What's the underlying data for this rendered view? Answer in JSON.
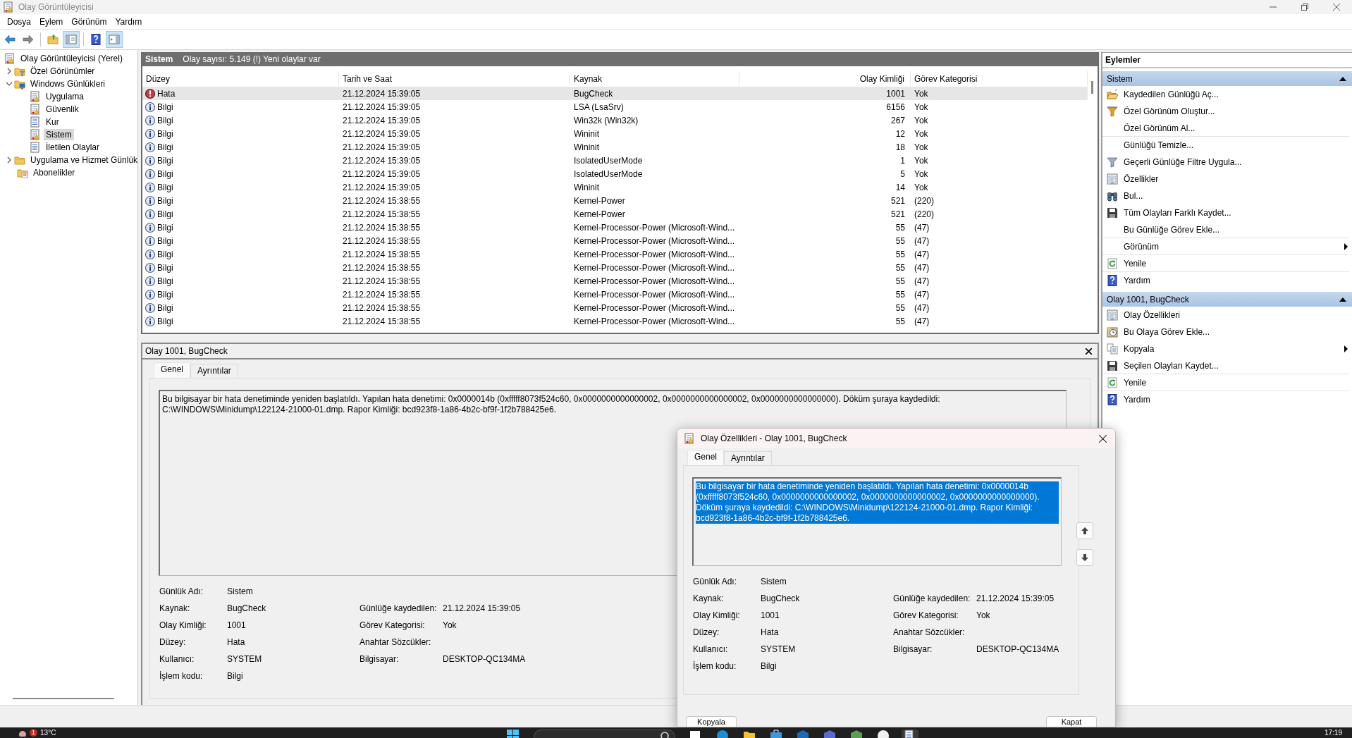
{
  "window": {
    "title": "Olay Görüntüleyicisi"
  },
  "menu": [
    "Dosya",
    "Eylem",
    "Görünüm",
    "Yardım"
  ],
  "toolbar": [
    {
      "kind": "back",
      "pressed": false
    },
    {
      "kind": "forward",
      "pressed": false
    },
    {
      "kind": "up-folder",
      "pressed": false
    },
    {
      "kind": "tree-pane",
      "pressed": true
    },
    {
      "kind": "help",
      "pressed": false
    },
    {
      "kind": "action-pane",
      "pressed": true
    }
  ],
  "tree": [
    {
      "label": "Olay Görüntüleyicisi (Yerel)",
      "kind": "log",
      "selected": false,
      "children": [
        {
          "label": "Özel Görünümler",
          "kind": "folder-filter",
          "selected": false,
          "expanded": false
        },
        {
          "label": "Windows Günlükleri",
          "kind": "folder-computer",
          "selected": false,
          "expanded": true,
          "children": [
            {
              "label": "Uygulama",
              "kind": "log",
              "selected": false
            },
            {
              "label": "Güvenlik",
              "kind": "log",
              "selected": false
            },
            {
              "label": "Kur",
              "kind": "plain-log",
              "selected": false
            },
            {
              "label": "Sistem",
              "kind": "log",
              "selected": true
            },
            {
              "label": "İletilen Olaylar",
              "kind": "plain-log",
              "selected": false
            }
          ]
        },
        {
          "label": "Uygulama ve Hizmet Günlük",
          "kind": "folder",
          "selected": false,
          "expanded": false
        },
        {
          "label": "Abonelikler",
          "kind": "folder-sub",
          "selected": false
        }
      ]
    }
  ],
  "log_header": {
    "name": "Sistem",
    "summary": "Olay sayısı: 5.149 (!) Yeni olaylar var"
  },
  "table": {
    "columns": [
      "Düzey",
      "Tarih ve Saat",
      "Kaynak",
      "Olay Kimliği",
      "Görev Kategorisi"
    ],
    "rows": [
      {
        "kind": "error",
        "severity": "Hata",
        "date": "21.12.2024 15:39:05",
        "source": "BugCheck",
        "id": "1001",
        "category": "Yok",
        "selected": true
      },
      {
        "kind": "info",
        "severity": "Bilgi",
        "date": "21.12.2024 15:39:05",
        "source": "LSA (LsaSrv)",
        "id": "6156",
        "category": "Yok",
        "selected": false
      },
      {
        "kind": "info",
        "severity": "Bilgi",
        "date": "21.12.2024 15:39:05",
        "source": "Win32k (Win32k)",
        "id": "267",
        "category": "Yok",
        "selected": false
      },
      {
        "kind": "info",
        "severity": "Bilgi",
        "date": "21.12.2024 15:39:05",
        "source": "Wininit",
        "id": "12",
        "category": "Yok",
        "selected": false
      },
      {
        "kind": "info",
        "severity": "Bilgi",
        "date": "21.12.2024 15:39:05",
        "source": "Wininit",
        "id": "18",
        "category": "Yok",
        "selected": false
      },
      {
        "kind": "info",
        "severity": "Bilgi",
        "date": "21.12.2024 15:39:05",
        "source": "IsolatedUserMode",
        "id": "1",
        "category": "Yok",
        "selected": false
      },
      {
        "kind": "info",
        "severity": "Bilgi",
        "date": "21.12.2024 15:39:05",
        "source": "IsolatedUserMode",
        "id": "5",
        "category": "Yok",
        "selected": false
      },
      {
        "kind": "info",
        "severity": "Bilgi",
        "date": "21.12.2024 15:39:05",
        "source": "Wininit",
        "id": "14",
        "category": "Yok",
        "selected": false
      },
      {
        "kind": "info",
        "severity": "Bilgi",
        "date": "21.12.2024 15:38:55",
        "source": "Kernel-Power",
        "id": "521",
        "category": "(220)",
        "selected": false
      },
      {
        "kind": "info",
        "severity": "Bilgi",
        "date": "21.12.2024 15:38:55",
        "source": "Kernel-Power",
        "id": "521",
        "category": "(220)",
        "selected": false
      },
      {
        "kind": "info",
        "severity": "Bilgi",
        "date": "21.12.2024 15:38:55",
        "source": "Kernel-Processor-Power (Microsoft-Wind...",
        "id": "55",
        "category": "(47)",
        "selected": false
      },
      {
        "kind": "info",
        "severity": "Bilgi",
        "date": "21.12.2024 15:38:55",
        "source": "Kernel-Processor-Power (Microsoft-Wind...",
        "id": "55",
        "category": "(47)",
        "selected": false
      },
      {
        "kind": "info",
        "severity": "Bilgi",
        "date": "21.12.2024 15:38:55",
        "source": "Kernel-Processor-Power (Microsoft-Wind...",
        "id": "55",
        "category": "(47)",
        "selected": false
      },
      {
        "kind": "info",
        "severity": "Bilgi",
        "date": "21.12.2024 15:38:55",
        "source": "Kernel-Processor-Power (Microsoft-Wind...",
        "id": "55",
        "category": "(47)",
        "selected": false
      },
      {
        "kind": "info",
        "severity": "Bilgi",
        "date": "21.12.2024 15:38:55",
        "source": "Kernel-Processor-Power (Microsoft-Wind...",
        "id": "55",
        "category": "(47)",
        "selected": false
      },
      {
        "kind": "info",
        "severity": "Bilgi",
        "date": "21.12.2024 15:38:55",
        "source": "Kernel-Processor-Power (Microsoft-Wind...",
        "id": "55",
        "category": "(47)",
        "selected": false
      },
      {
        "kind": "info",
        "severity": "Bilgi",
        "date": "21.12.2024 15:38:55",
        "source": "Kernel-Processor-Power (Microsoft-Wind...",
        "id": "55",
        "category": "(47)",
        "selected": false
      },
      {
        "kind": "info",
        "severity": "Bilgi",
        "date": "21.12.2024 15:38:55",
        "source": "Kernel-Processor-Power (Microsoft-Wind...",
        "id": "55",
        "category": "(47)",
        "selected": false
      }
    ]
  },
  "detail": {
    "title": "Olay 1001, BugCheck",
    "tabs": [
      {
        "label": "Genel",
        "selected": true
      },
      {
        "label": "Ayrıntılar",
        "selected": false
      }
    ],
    "description": "Bu bilgisayar bir hata denetiminde yeniden başlatıldı. Yapılan hata denetimi: 0x0000014b (0xfffff8073f524c60, 0x0000000000000002, 0x0000000000000002, 0x0000000000000000). Döküm şuraya kaydedildi: C:\\WINDOWS\\Minidump\\122124-21000-01.dmp. Rapor Kimliği: bcd923f8-1a86-4b2c-bf9f-1f2b788425e6.",
    "text_selected": false,
    "fields_left": [
      {
        "label": "Günlük Adı:",
        "value": "Sistem"
      },
      {
        "label": "Kaynak:",
        "value": "BugCheck"
      },
      {
        "label": "Olay Kimliği:",
        "value": "1001"
      },
      {
        "label": "Düzey:",
        "value": "Hata"
      },
      {
        "label": "Kullanıcı:",
        "value": "SYSTEM"
      },
      {
        "label": "İşlem kodu:",
        "value": "Bilgi"
      }
    ],
    "fields_right": [
      {
        "label": "Günlüğe kaydedilen:",
        "value": "21.12.2024 15:39:05"
      },
      {
        "label": "Görev Kategorisi:",
        "value": "Yok"
      },
      {
        "label": "Anahtar Sözcükler:"
      },
      {
        "label": "Bilgisayar:",
        "value": "DESKTOP-QC134MA"
      }
    ]
  },
  "actions": {
    "title": "Eylemler",
    "sections": [
      {
        "title": "Sistem",
        "expanded": true,
        "items": [
          {
            "label": "Kaydedilen Günlüğü Aç...",
            "kind": "open-folder",
            "submenu": false,
            "divider": false
          },
          {
            "label": "Özel Görünüm Oluştur...",
            "kind": "filter-star",
            "submenu": false,
            "divider": false
          },
          {
            "label": "Özel Görünüm Al...",
            "submenu": false,
            "divider": true
          },
          {
            "label": "Günlüğü Temizle...",
            "submenu": false,
            "divider": false
          },
          {
            "label": "Geçerli Günlüğe Filtre Uygula...",
            "kind": "filter",
            "submenu": false,
            "divider": false
          },
          {
            "label": "Özellikler",
            "kind": "properties",
            "submenu": false,
            "divider": false
          },
          {
            "label": "Bul...",
            "kind": "binoculars",
            "submenu": false,
            "divider": false
          },
          {
            "label": "Tüm Olayları Farklı Kaydet...",
            "kind": "save",
            "submenu": false,
            "divider": false
          },
          {
            "label": "Bu Günlüğe Görev Ekle...",
            "submenu": false,
            "divider": true
          },
          {
            "label": "Görünüm",
            "submenu": true,
            "divider": true
          },
          {
            "label": "Yenile",
            "kind": "refresh",
            "submenu": false,
            "divider": true
          },
          {
            "label": "Yardım",
            "kind": "help",
            "submenu": false,
            "divider": false
          }
        ]
      },
      {
        "title": "Olay 1001, BugCheck",
        "expanded": true,
        "items": [
          {
            "label": "Olay Özellikleri",
            "kind": "properties",
            "submenu": false,
            "divider": false
          },
          {
            "label": "Bu Olaya Görev Ekle...",
            "kind": "task",
            "submenu": false,
            "divider": false
          },
          {
            "label": "Kopyala",
            "kind": "copy",
            "submenu": true,
            "divider": false
          },
          {
            "label": "Seçilen Olayları Kaydet...",
            "kind": "save",
            "submenu": false,
            "divider": true
          },
          {
            "label": "Yenile",
            "kind": "refresh",
            "submenu": false,
            "divider": true
          },
          {
            "label": "Yardım",
            "kind": "help",
            "submenu": false,
            "divider": false
          }
        ]
      }
    ]
  },
  "dialog": {
    "title": "Olay Özellikleri - Olay 1001, BugCheck",
    "tabs": [
      {
        "label": "Genel",
        "selected": true
      },
      {
        "label": "Ayrıntılar",
        "selected": false
      }
    ],
    "description": "Bu bilgisayar bir hata denetiminde yeniden başlatıldı. Yapılan hata denetimi: 0x0000014b (0xfffff8073f524c60, 0x0000000000000002, 0x0000000000000002, 0x0000000000000000). Döküm şuraya kaydedildi: C:\\WINDOWS\\Minidump\\122124-21000-01.dmp. Rapor Kimliği: bcd923f8-1a86-4b2c-bf9f-1f2b788425e6.",
    "text_selected": true,
    "fields_left": [
      {
        "label": "Günlük Adı:",
        "value": "Sistem"
      },
      {
        "label": "Kaynak:",
        "value": "BugCheck"
      },
      {
        "label": "Olay Kimliği:",
        "value": "1001"
      },
      {
        "label": "Düzey:",
        "value": "Hata"
      },
      {
        "label": "Kullanıcı:",
        "value": "SYSTEM"
      },
      {
        "label": "İşlem kodu:",
        "value": "Bilgi"
      }
    ],
    "fields_right": [
      {
        "label": "Günlüğe kaydedilen:",
        "value": "21.12.2024 15:39:05"
      },
      {
        "label": "Görev Kategorisi:",
        "value": "Yok"
      },
      {
        "label": "Anahtar Sözcükler:"
      },
      {
        "label": "Bilgisayar:",
        "value": "DESKTOP-QC134MA"
      }
    ],
    "buttons": [
      "Kopyala",
      "Kapat"
    ]
  },
  "taskbar": {
    "weather_badge": "1",
    "temperature": "13°C",
    "apps": [
      {
        "kind": "start",
        "selected": false
      },
      {
        "kind": "search",
        "selected": false
      },
      {
        "kind": "task-view",
        "selected": false
      },
      {
        "kind": "edge",
        "selected": false
      },
      {
        "kind": "files",
        "selected": false
      },
      {
        "kind": "store",
        "selected": false
      },
      {
        "kind": "mail",
        "selected": false
      },
      {
        "kind": "app-blue",
        "selected": false
      },
      {
        "kind": "app-green",
        "selected": false
      },
      {
        "kind": "chrome",
        "selected": false
      },
      {
        "kind": "event-viewer",
        "selected": true
      }
    ],
    "time": "17:19"
  }
}
